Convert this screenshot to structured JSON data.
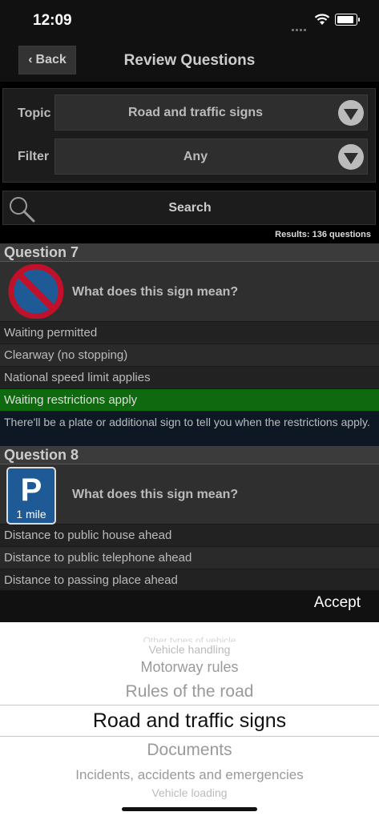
{
  "status": {
    "time": "12:09"
  },
  "nav": {
    "back_label": "Back",
    "title": "Review Questions"
  },
  "filters": {
    "topic_label": "Topic",
    "topic_value": "Road and traffic signs",
    "filter_label": "Filter",
    "filter_value": "Any"
  },
  "search": {
    "label": "Search"
  },
  "results_text": "Results: 136 questions",
  "questions": [
    {
      "header": "Question 7",
      "prompt": "What does this sign mean?",
      "sign_icon": "no-waiting-sign-icon",
      "answers": [
        "Waiting permitted",
        "Clearway (no stopping)",
        "National speed limit applies",
        "Waiting restrictions apply"
      ],
      "correct_index": 3,
      "explanation": "There'll be a plate or additional sign to tell you when the restrictions apply."
    },
    {
      "header": "Question 8",
      "prompt": "What does this sign mean?",
      "sign_icon": "parking-one-mile-sign-icon",
      "sign_letter": "P",
      "sign_text": "1 mile",
      "answers": [
        "Distance to public house ahead",
        "Distance to public telephone ahead",
        "Distance to passing place ahead"
      ]
    }
  ],
  "accept_label": "Accept",
  "picker": {
    "items": [
      "Other types of vehicle",
      "Vehicle handling",
      "Motorway rules",
      "Rules of the road",
      "Road and traffic signs",
      "Documents",
      "Incidents, accidents and emergencies",
      "Vehicle loading"
    ],
    "selected": "Road and traffic signs"
  },
  "colors": {
    "correct": "#0f6a0f",
    "explanation_bg": "#0d1824",
    "sign_blue": "#1e5a96",
    "sign_red": "#c0102a"
  }
}
